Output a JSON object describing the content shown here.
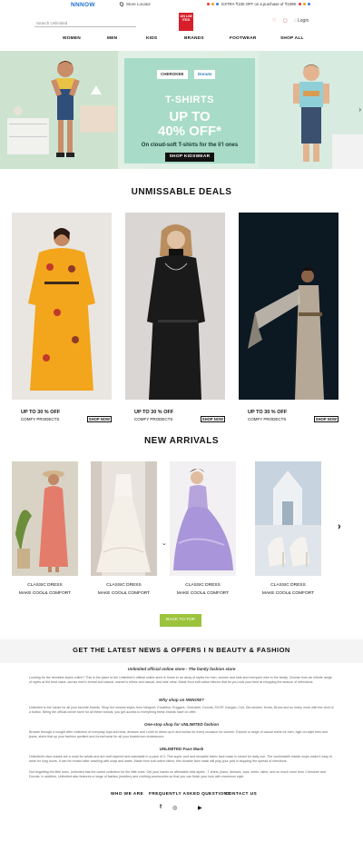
{
  "topbar": {
    "brand": "NNNOW",
    "store_locator": "Store Locator",
    "promo": "EXTRA ₹100 OFF on a purchase of ₹1099"
  },
  "header": {
    "search_placeholder": "Search Unlimited",
    "logo_text": "UN LIM ITED",
    "login": "Login"
  },
  "nav": [
    "WOMEN",
    "MEN",
    "KIDS",
    "BRANDS",
    "FOOTWEAR",
    "SHOP ALL"
  ],
  "hero": {
    "brand1": "CHEROKEE",
    "brand2": "Donuts",
    "line1": "T-SHIRTS",
    "line2": "UP TO",
    "line3": "40% OFF*",
    "line4": "On cloud-soft T-shirts for the li'l ones",
    "cta": "SHOP KIDSWEAR"
  },
  "deals": {
    "title": "UNMISSABLE DEALS",
    "items": [
      {
        "offer": "UP TO 30 % OFF",
        "sub": "COMFY PRODECTS",
        "cta": "SHOP NOW"
      },
      {
        "offer": "UP TO 30 % OFF",
        "sub": "COMFY PRODECTS",
        "cta": "SHOP NOW"
      },
      {
        "offer": "UP TO 30 % OFF",
        "sub": "COMFY PRODECTS",
        "cta": "SHOP NOW"
      }
    ]
  },
  "arrivals": {
    "title": "NEW ARRIVALS",
    "items": [
      {
        "name": "CLASSIC DRESS",
        "sub": "MAKE COOL& COMFORT"
      },
      {
        "name": "CLASSIC DRESS",
        "sub": "MAKE COOL& COMFORT"
      },
      {
        "name": "CLASSIC DRESS",
        "sub": "MAKE COOL& COMFORT"
      },
      {
        "name": "CLASSIC DRESS",
        "sub": "MAKE COOL& COMFORT"
      }
    ]
  },
  "back_to_top": "BACK TO TOP",
  "news": {
    "title": "GET THE LATEST NEWS & OFFERS I N BEAUTY & FASHION",
    "h1": "Unlimited official online store - The family fashion store",
    "p1": "Looking for the trendiest styles online? This is the place to be! Unlimited's official online store is home to an array of styles for men, women and kids and everyone else in the family. Choose from an infinite range of styles at the best value, across men's formal and casual, women's ethnic and casual, and kids’ wear. Made from soft cotton fabrics that let you look your best at shopping the season of reflections.",
    "h2": "Why shop on NNNOW?",
    "p2": "Unlimited is the house for all your favorite brands. Shop the newest styles from Newport, Excalibur, Ruggers, Cherokee, Donuts, SVOP, Karigari, Colt, Dia strokes, Knots, Bronx and so many more with the click of a button. Being the official online store for all these brands, you get access to everything these brands have on offer.",
    "h3": "One-stop shop for UNLIMITED fashion",
    "p3": "Browse through a sought after collection of everyday tops and teas, dresses and t-shirt to dress up in and kurtas for every occasion for women. Explore a range of casual shirts for men, high-on-style tees and jeans, shirts that up your fashion quotient and formal wear for all your boardroom endeavours.",
    "h4": "UNLIMITED Face Mask",
    "p4": "Unlimited's face masks are a must for adults and are both layered and washable in a pack of 3. This super cool and reusable fabric face mask is meant for daily use. The comfortable elastic loops make it easy to wear for long hours. It can be reused after washing with soap and water. Made from soft cotton fabric, this durable face mask will play your part in stopping the spread of infections.",
    "p5": "Not forgetting the little ones, Unlimited has the cutest collection for the little ones. Get your hands on affordable kids styles - T-shirts, jeans, dresses, tops, shirts, skirts, and so much more from Cherokee and Donuts. In addition, Unlimited also features a range of fashion jewellery and clothing accessories so that you can finish your look with maximum style."
  },
  "footer": {
    "links": [
      "WHO WE ARE",
      "FREQUENTLY ASKED QUESTIONS",
      "CONTACT US"
    ],
    "social": [
      "f",
      "◎",
      "▶"
    ]
  },
  "colors": {
    "accent_green": "#9cc33c",
    "logo_red": "#d81e2a",
    "brand_blue": "#1a6fd1"
  }
}
